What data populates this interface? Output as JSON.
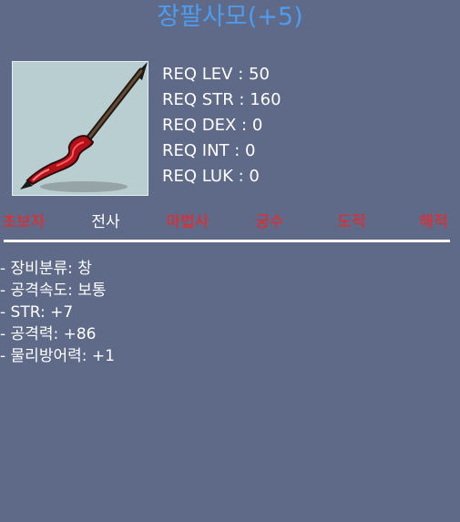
{
  "item": {
    "name": "장팔사모(+5)",
    "icon": "red-spear-icon"
  },
  "requirements": [
    "REQ LEV : 50",
    "REQ STR : 160",
    "REQ DEX : 0",
    "REQ INT : 0",
    "REQ LUK : 0"
  ],
  "jobs": [
    {
      "label": "초보자",
      "available": false
    },
    {
      "label": "전사",
      "available": true
    },
    {
      "label": "마법사",
      "available": false
    },
    {
      "label": "궁수",
      "available": false
    },
    {
      "label": "도적",
      "available": false
    },
    {
      "label": "해적",
      "available": false
    }
  ],
  "stats": [
    "- 장비분류: 창",
    "- 공격속도: 보통",
    "- STR: +7",
    "- 공격력: +86",
    "- 물리방어력: +1"
  ],
  "colors": {
    "background": "#5e6a88",
    "title": "#4d9cf0",
    "unavailable_job": "#ff1f1f",
    "available_job": "#ffffff",
    "text": "#ffffff"
  }
}
